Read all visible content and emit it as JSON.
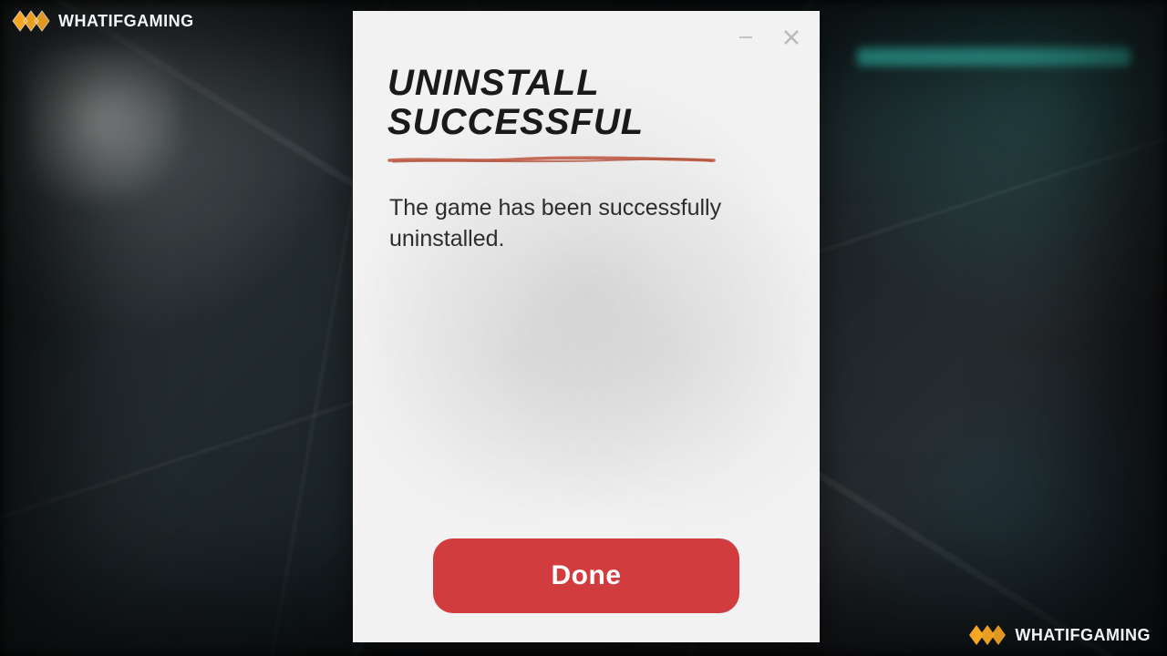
{
  "watermark": {
    "text": "WHATIFGAMING"
  },
  "dialog": {
    "title_line1": "UNINSTALL",
    "title_line2": "SUCCESSFUL",
    "message": "The game has been successfully uninstalled.",
    "done_label": "Done"
  },
  "colors": {
    "accent_red": "#d13d3f",
    "underline_red": "#c36a58"
  }
}
